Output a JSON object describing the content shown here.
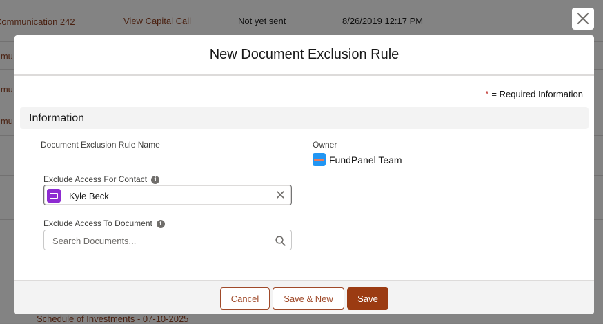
{
  "background": {
    "rows": [
      {
        "name": "Communication 242",
        "action": "View Capital Call",
        "status": "Not yet sent",
        "date": "8/26/2019 12:17 PM"
      },
      {
        "name": "mmu",
        "action": "",
        "status": "",
        "date": ""
      },
      {
        "name": "mmu",
        "action": "",
        "status": "",
        "date": ""
      },
      {
        "name": "mmu",
        "action": "",
        "status": "",
        "date": ""
      }
    ],
    "bottom_link": "Schedule of Investments - 07-10-2025"
  },
  "modal": {
    "title": "New Document Exclusion Rule",
    "required_star": "*",
    "required_note": "= Required Information",
    "section_title": "Information",
    "fields": {
      "rule_name_label": "Document Exclusion Rule Name",
      "owner_label": "Owner",
      "owner_value": "FundPanel Team",
      "contact_label": "Exclude Access For Contact",
      "contact_value": "Kyle Beck",
      "document_label": "Exclude Access To Document",
      "document_placeholder": "Search Documents...",
      "info_glyph": "i"
    },
    "footer": {
      "cancel_label": "Cancel",
      "save_new_label": "Save & New",
      "save_label": "Save"
    }
  },
  "icons": {
    "close": "close-icon",
    "info": "info-icon",
    "contact": "contact-card-icon",
    "clear": "clear-icon",
    "search": "search-icon",
    "owner_avatar": "owner-avatar-icon"
  },
  "colors": {
    "brand": "#9b3b12",
    "link": "#8c3a1b",
    "contact_icon": "#8e2bd1",
    "owner_avatar": "#2196f3"
  }
}
